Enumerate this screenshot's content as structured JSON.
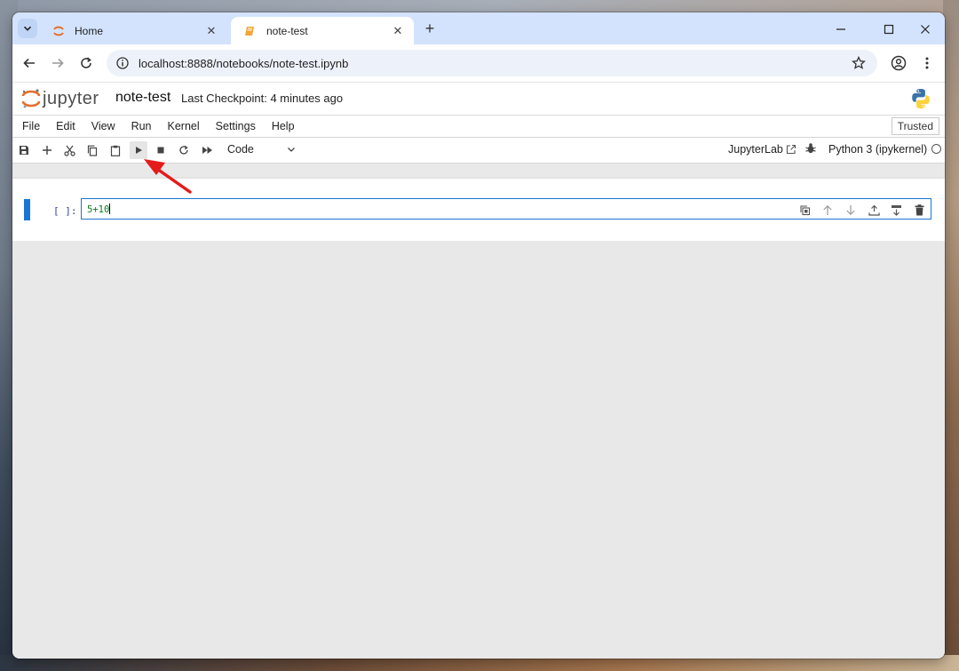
{
  "browser": {
    "tabs": [
      {
        "title": "Home",
        "icon": "jupyter-favicon",
        "active": false
      },
      {
        "title": "note-test",
        "icon": "notebook-favicon",
        "active": true
      }
    ],
    "url": "localhost:8888/notebooks/note-test.ipynb"
  },
  "jupyter": {
    "logo_text": "jupyter",
    "notebook_name": "note-test",
    "checkpoint": "Last Checkpoint: 4 minutes ago",
    "menu": [
      "File",
      "Edit",
      "View",
      "Run",
      "Kernel",
      "Settings",
      "Help"
    ],
    "trusted_label": "Trusted",
    "cell_type": "Code",
    "jupyterlab_label": "JupyterLab",
    "kernel_name": "Python 3 (ipykernel)"
  },
  "cell": {
    "prompt": "[ ]:",
    "code": "5+10"
  },
  "colors": {
    "accent": "#1976d2",
    "code_green": "#0a7d22",
    "annotation_arrow": "#e41b1b",
    "tabstrip": "#d3e3fd"
  }
}
